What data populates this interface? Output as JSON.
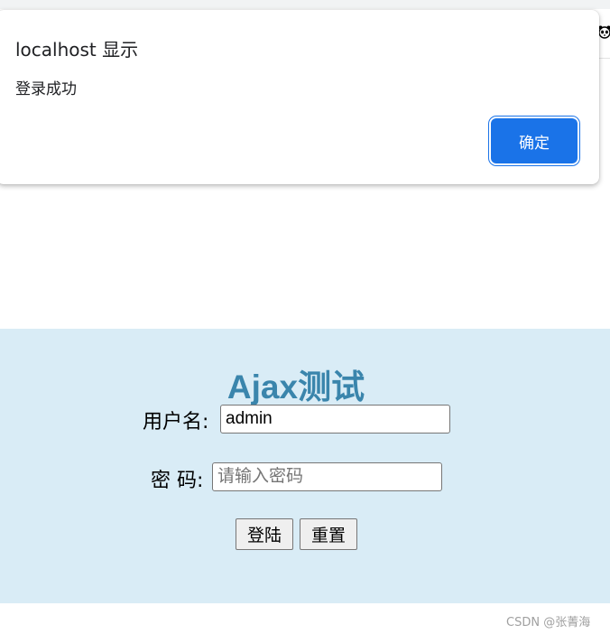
{
  "alert": {
    "title": "localhost 显示",
    "message": "登录成功",
    "ok_label": "确定"
  },
  "login": {
    "title": "Ajax测试",
    "username_label": "用户名:",
    "username_value": "admin",
    "password_label": "密 码:",
    "password_placeholder": "请输入密码",
    "login_label": "登陆",
    "reset_label": "重置"
  },
  "watermark": "CSDN @张菁海",
  "colors": {
    "panel_background": "#d9ecf6",
    "title_color": "#3a85ac",
    "alert_button": "#1a73e8"
  },
  "icons": {
    "toolbar_extension": "panda-icon"
  }
}
